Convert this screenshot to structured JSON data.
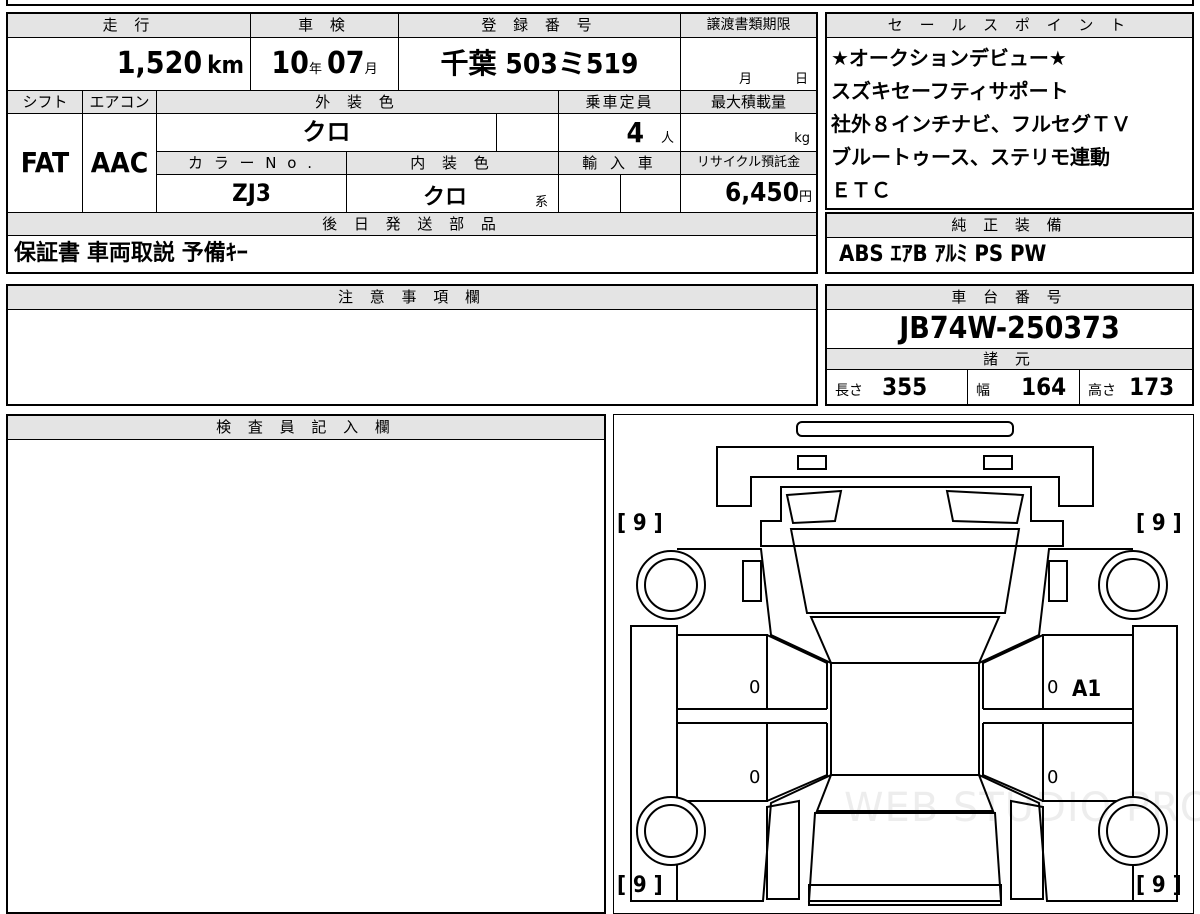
{
  "basic": {
    "mileage_label": "走 行",
    "mileage_value": "1,520",
    "mileage_unit": "km",
    "inspection_label": "車 検",
    "inspection_year": "10",
    "inspection_year_unit": "年",
    "inspection_month": "07",
    "inspection_month_unit": "月",
    "registration_label": "登 録 番 号",
    "registration_value": "千葉 503ミ519",
    "transfer_label": "譲渡書類期限",
    "transfer_month_unit": "月",
    "transfer_day_unit": "日",
    "shift_label": "シフト",
    "shift_value": "FAT",
    "aircon_label": "エアコン",
    "aircon_value": "AAC",
    "exterior_label": "外 装 色",
    "exterior_value": "クロ",
    "capacity_label": "乗車定員",
    "capacity_value": "4",
    "capacity_unit": "人",
    "maxload_label": "最大積載量",
    "maxload_unit": "kg",
    "color_no_label": "カ ラ ー N o .",
    "color_no_value": "ZJ3",
    "interior_label": "内 装 色",
    "interior_value": "クロ",
    "interior_suffix": "系",
    "import_label": "輸 入 車",
    "recycle_label": "リサイクル預託金",
    "recycle_value": "6,450",
    "recycle_unit": "円",
    "later_label": "後 日 発 送 部 品",
    "later_value": "保証書 車両取説 予備ｷｰ"
  },
  "sales": {
    "label": "セ ー ル ス ポ イ ン ト",
    "lines": [
      "★オークションデビュー★",
      "スズキセーフティサポート",
      "社外８インチナビ、フルセグＴＶ",
      "ブルートゥース、ステリモ連動",
      "ＥＴＣ"
    ]
  },
  "equipment": {
    "label": "純 正 装 備",
    "value": "ABS ｴｱB ｱﾙﾐ PS PW"
  },
  "notes": {
    "label": "注 意 事 項 欄"
  },
  "chassis": {
    "label": "車 台 番 号",
    "value": "JB74W-250373",
    "spec_label": "諸 元",
    "length_label": "長さ",
    "length_value": "355",
    "width_label": "幅",
    "width_value": "164",
    "height_label": "高さ",
    "height_value": "173"
  },
  "inspector": {
    "label": "検 査 員 記 入 欄"
  },
  "diagram": {
    "tire_fl": "[ 9 ]",
    "tire_fr": "[ 9 ]",
    "tire_rl": "[ 9 ]",
    "tire_rr": "[ 9 ]",
    "door_left_front": "0",
    "door_left_rear": "0",
    "door_right_front": "0",
    "door_right_rear": "0",
    "damage_code": "A1",
    "watermark": "WEB STUDIO PRO"
  }
}
